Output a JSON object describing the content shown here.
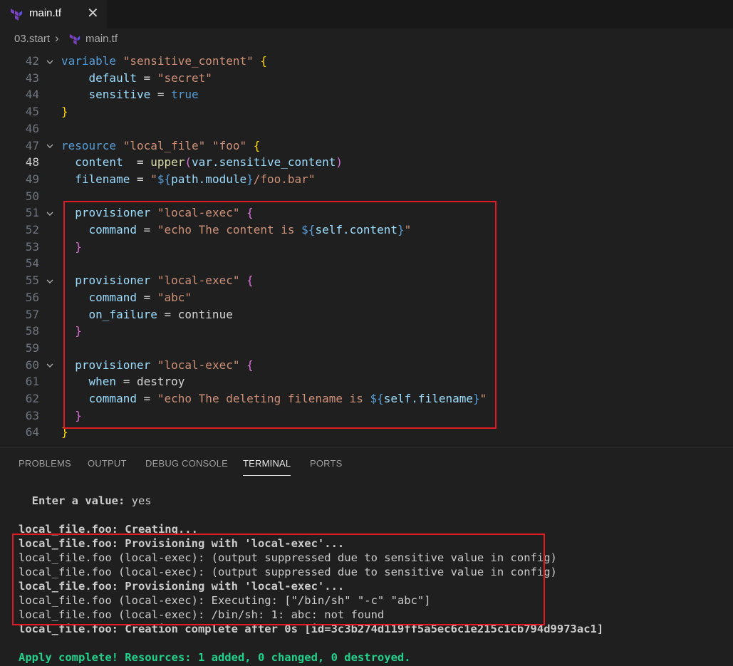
{
  "tabs": [
    {
      "label": "main.tf",
      "close": "✕",
      "icon": "terraform-icon"
    }
  ],
  "breadcrumb": {
    "folder": "03.start",
    "separator": "›",
    "file": "main.tf"
  },
  "editor": {
    "lines": [
      {
        "n": "42",
        "fold": true,
        "t": [
          [
            "k",
            "variable"
          ],
          [
            "t",
            " "
          ],
          [
            "s",
            "\"sensitive_content\""
          ],
          [
            "t",
            " "
          ],
          [
            "b1",
            "{"
          ]
        ]
      },
      {
        "n": "43",
        "t": [
          [
            "t",
            "    "
          ],
          [
            "v",
            "default"
          ],
          [
            "p",
            " = "
          ],
          [
            "s",
            "\"secret\""
          ]
        ]
      },
      {
        "n": "44",
        "t": [
          [
            "t",
            "    "
          ],
          [
            "v",
            "sensitive"
          ],
          [
            "p",
            " = "
          ],
          [
            "k",
            "true"
          ]
        ]
      },
      {
        "n": "45",
        "t": [
          [
            "b1",
            "}"
          ]
        ]
      },
      {
        "n": "46",
        "t": []
      },
      {
        "n": "47",
        "fold": true,
        "t": [
          [
            "k",
            "resource"
          ],
          [
            "t",
            " "
          ],
          [
            "s",
            "\"local_file\""
          ],
          [
            "t",
            " "
          ],
          [
            "s",
            "\"foo\""
          ],
          [
            "t",
            " "
          ],
          [
            "b1",
            "{"
          ]
        ]
      },
      {
        "n": "48",
        "active": true,
        "t": [
          [
            "t",
            "  "
          ],
          [
            "v",
            "content"
          ],
          [
            "p",
            "  = "
          ],
          [
            "f",
            "upper"
          ],
          [
            "b2",
            "("
          ],
          [
            "v",
            "var.sensitive_content"
          ],
          [
            "b2",
            ")"
          ]
        ]
      },
      {
        "n": "49",
        "t": [
          [
            "t",
            "  "
          ],
          [
            "v",
            "filename"
          ],
          [
            "p",
            " = "
          ],
          [
            "s",
            "\""
          ],
          [
            "k",
            "${"
          ],
          [
            "v",
            "path.module"
          ],
          [
            "k",
            "}"
          ],
          [
            "s",
            "/foo.bar\""
          ]
        ]
      },
      {
        "n": "50",
        "t": []
      },
      {
        "n": "51",
        "fold": true,
        "t": [
          [
            "t",
            "  "
          ],
          [
            "v",
            "provisioner"
          ],
          [
            "t",
            " "
          ],
          [
            "s",
            "\"local-exec\""
          ],
          [
            "t",
            " "
          ],
          [
            "b2",
            "{"
          ]
        ]
      },
      {
        "n": "52",
        "t": [
          [
            "t",
            "    "
          ],
          [
            "v",
            "command"
          ],
          [
            "p",
            " = "
          ],
          [
            "s",
            "\"echo The content is "
          ],
          [
            "k",
            "${"
          ],
          [
            "v",
            "self.content"
          ],
          [
            "k",
            "}"
          ],
          [
            "s",
            "\""
          ]
        ]
      },
      {
        "n": "53",
        "t": [
          [
            "t",
            "  "
          ],
          [
            "b2",
            "}"
          ]
        ]
      },
      {
        "n": "54",
        "t": []
      },
      {
        "n": "55",
        "fold": true,
        "t": [
          [
            "t",
            "  "
          ],
          [
            "v",
            "provisioner"
          ],
          [
            "t",
            " "
          ],
          [
            "s",
            "\"local-exec\""
          ],
          [
            "t",
            " "
          ],
          [
            "b2",
            "{"
          ]
        ]
      },
      {
        "n": "56",
        "t": [
          [
            "t",
            "    "
          ],
          [
            "v",
            "command"
          ],
          [
            "p",
            " = "
          ],
          [
            "s",
            "\"abc\""
          ]
        ]
      },
      {
        "n": "57",
        "t": [
          [
            "t",
            "    "
          ],
          [
            "v",
            "on_failure"
          ],
          [
            "p",
            " = "
          ],
          [
            "t",
            "continue"
          ]
        ]
      },
      {
        "n": "58",
        "t": [
          [
            "t",
            "  "
          ],
          [
            "b2",
            "}"
          ]
        ]
      },
      {
        "n": "59",
        "t": []
      },
      {
        "n": "60",
        "fold": true,
        "t": [
          [
            "t",
            "  "
          ],
          [
            "v",
            "provisioner"
          ],
          [
            "t",
            " "
          ],
          [
            "s",
            "\"local-exec\""
          ],
          [
            "t",
            " "
          ],
          [
            "b2",
            "{"
          ]
        ]
      },
      {
        "n": "61",
        "t": [
          [
            "t",
            "    "
          ],
          [
            "v",
            "when"
          ],
          [
            "p",
            " = "
          ],
          [
            "t",
            "destroy"
          ]
        ]
      },
      {
        "n": "62",
        "t": [
          [
            "t",
            "    "
          ],
          [
            "v",
            "command"
          ],
          [
            "p",
            " = "
          ],
          [
            "s",
            "\"echo The deleting filename is "
          ],
          [
            "k",
            "${"
          ],
          [
            "v",
            "self.filename"
          ],
          [
            "k",
            "}"
          ],
          [
            "s",
            "\""
          ]
        ]
      },
      {
        "n": "63",
        "t": [
          [
            "t",
            "  "
          ],
          [
            "b2",
            "}"
          ]
        ]
      },
      {
        "n": "64",
        "t": [
          [
            "b1",
            "}"
          ]
        ]
      }
    ]
  },
  "panel": {
    "tabs": [
      "PROBLEMS",
      "OUTPUT",
      "DEBUG CONSOLE",
      "TERMINAL",
      "PORTS"
    ],
    "active_tab": "TERMINAL"
  },
  "terminal": {
    "prompt_label": "  Enter a value:",
    "prompt_answer": " yes",
    "lines": [
      "local_file.foo: Creating...",
      "local_file.foo: Provisioning with 'local-exec'...",
      "local_file.foo (local-exec): (output suppressed due to sensitive value in config)",
      "local_file.foo (local-exec): (output suppressed due to sensitive value in config)",
      "local_file.foo: Provisioning with 'local-exec'...",
      "local_file.foo (local-exec): Executing: [\"/bin/sh\" \"-c\" \"abc\"]",
      "local_file.foo (local-exec): /bin/sh: 1: abc: not found",
      "local_file.foo: Creation complete after 0s [id=3c3b274d119ff5a5ec6c1e215c1cb794d9973ac1]"
    ],
    "final": "Apply complete! Resources: 1 added, 0 changed, 0 destroyed."
  }
}
